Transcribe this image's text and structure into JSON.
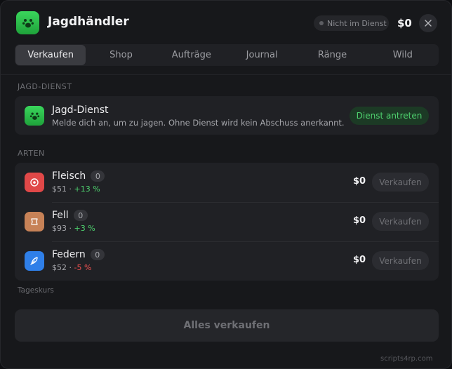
{
  "header": {
    "title": "Jagdhändler",
    "status": "Nicht im Dienst",
    "balance": "$0",
    "icon": "paw-icon"
  },
  "tabs": [
    {
      "label": "Verkaufen",
      "active": true
    },
    {
      "label": "Shop",
      "active": false
    },
    {
      "label": "Aufträge",
      "active": false
    },
    {
      "label": "Journal",
      "active": false
    },
    {
      "label": "Ränge",
      "active": false
    },
    {
      "label": "Wild",
      "active": false
    }
  ],
  "duty_section": {
    "label": "JAGD-DIENST",
    "title": "Jagd-Dienst",
    "description": "Melde dich an, um zu jagen. Ohne Dienst wird kein Abschuss anerkannt.",
    "button": "Dienst antreten",
    "icon": "paw-icon"
  },
  "species_section": {
    "label": "ARTEN",
    "rows": [
      {
        "name": "Fleisch",
        "count": "0",
        "price": "$51",
        "sep": "·",
        "change": "+13 %",
        "change_dir": "up",
        "value": "$0",
        "button": "Verkaufen",
        "icon": "meat-icon",
        "color": "#e04848"
      },
      {
        "name": "Fell",
        "count": "0",
        "price": "$93",
        "sep": "·",
        "change": "+3 %",
        "change_dir": "up",
        "value": "$0",
        "button": "Verkaufen",
        "icon": "hide-icon",
        "color": "#c78257"
      },
      {
        "name": "Federn",
        "count": "0",
        "price": "$52",
        "sep": "·",
        "change": "-5 %",
        "change_dir": "down",
        "value": "$0",
        "button": "Verkaufen",
        "icon": "feather-icon",
        "color": "#2f7fe8"
      }
    ]
  },
  "tageskurs": "Tageskurs",
  "sell_all": "Alles verkaufen",
  "footer": "scripts4rp.com",
  "colors": {
    "accent_green": "#3ad65c",
    "positive": "#4fd36f",
    "negative": "#ef5050"
  }
}
